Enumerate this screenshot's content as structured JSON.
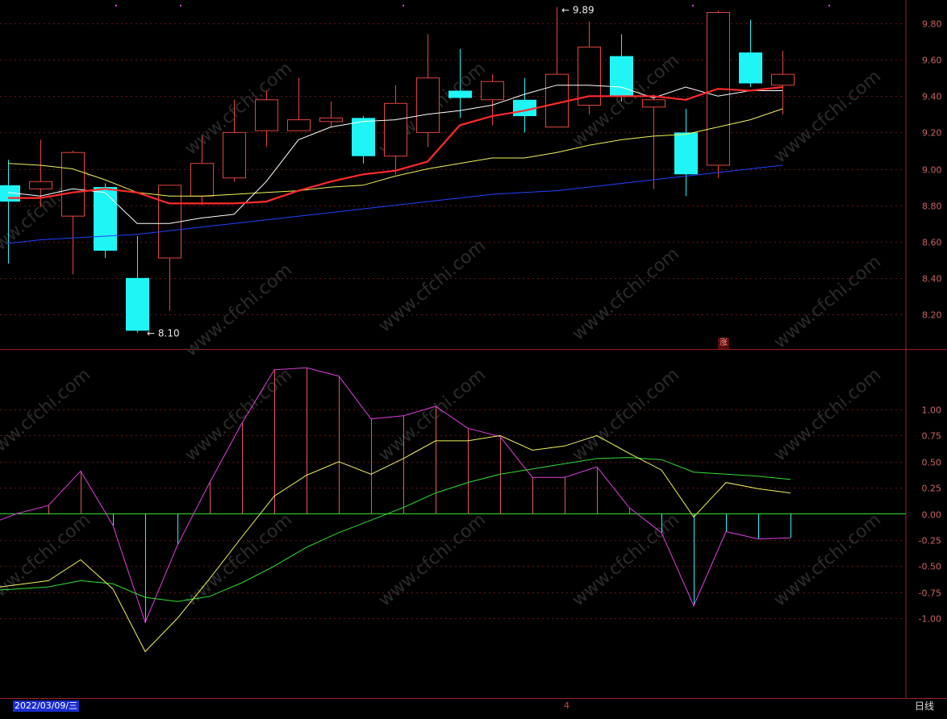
{
  "bottom_bar": {
    "date": "2022/03/09/三",
    "period": "日线",
    "cursor": "4"
  },
  "badge": {
    "rise_char": "涨"
  },
  "watermark": "www.cfchi.com",
  "colors": {
    "up": "#e0463e",
    "down": "#20f5f5",
    "grid": "#6a1414",
    "axis_text": "#c86464",
    "ma5": "#ffffff",
    "ma10": "#ff2a2a",
    "ma20": "#f2f25a",
    "ma60": "#2040ff",
    "dif": "#f2f25a",
    "dea": "#30e030",
    "macd_pos": "#e05a5a",
    "macd_neg": "#20f5f5",
    "macd_line": "#e040e0"
  },
  "chart_data": [
    {
      "type": "candlestick",
      "ylim": [
        8.0,
        9.9
      ],
      "y_ticks": [
        "9.80",
        "9.60",
        "9.40",
        "9.20",
        "9.00",
        "8.80",
        "8.60",
        "8.40",
        "8.20"
      ],
      "annotations": {
        "high": "9.89",
        "low": "8.10"
      },
      "candles": [
        {
          "o": 8.91,
          "h": 9.05,
          "l": 8.48,
          "c": 8.82
        },
        {
          "o": 8.89,
          "h": 9.16,
          "l": 8.79,
          "c": 8.93
        },
        {
          "o": 8.74,
          "h": 9.1,
          "l": 8.42,
          "c": 9.09
        },
        {
          "o": 8.9,
          "h": 8.92,
          "l": 8.51,
          "c": 8.55
        },
        {
          "o": 8.4,
          "h": 8.63,
          "l": 8.1,
          "c": 8.11
        },
        {
          "o": 8.51,
          "h": 8.91,
          "l": 8.22,
          "c": 8.91
        },
        {
          "o": 8.85,
          "h": 9.18,
          "l": 8.8,
          "c": 9.03
        },
        {
          "o": 8.95,
          "h": 9.38,
          "l": 8.93,
          "c": 9.2
        },
        {
          "o": 9.21,
          "h": 9.43,
          "l": 9.12,
          "c": 9.38
        },
        {
          "o": 9.21,
          "h": 9.5,
          "l": 9.21,
          "c": 9.27
        },
        {
          "o": 9.26,
          "h": 9.37,
          "l": 9.23,
          "c": 9.28
        },
        {
          "o": 9.28,
          "h": 9.29,
          "l": 9.03,
          "c": 9.07
        },
        {
          "o": 9.07,
          "h": 9.46,
          "l": 8.97,
          "c": 9.36
        },
        {
          "o": 9.2,
          "h": 9.74,
          "l": 9.12,
          "c": 9.5
        },
        {
          "o": 9.43,
          "h": 9.66,
          "l": 9.28,
          "c": 9.39
        },
        {
          "o": 9.38,
          "h": 9.52,
          "l": 9.24,
          "c": 9.48
        },
        {
          "o": 9.38,
          "h": 9.5,
          "l": 9.2,
          "c": 9.29
        },
        {
          "o": 9.23,
          "h": 9.89,
          "l": 9.23,
          "c": 9.52
        },
        {
          "o": 9.35,
          "h": 9.81,
          "l": 9.3,
          "c": 9.67
        },
        {
          "o": 9.62,
          "h": 9.74,
          "l": 9.37,
          "c": 9.4
        },
        {
          "o": 9.34,
          "h": 9.41,
          "l": 8.89,
          "c": 9.38
        },
        {
          "o": 9.2,
          "h": 9.33,
          "l": 8.85,
          "c": 8.97
        },
        {
          "o": 9.02,
          "h": 9.87,
          "l": 8.95,
          "c": 9.86
        },
        {
          "o": 9.64,
          "h": 9.82,
          "l": 9.45,
          "c": 9.47
        },
        {
          "o": 9.46,
          "h": 9.65,
          "l": 9.3,
          "c": 9.52
        }
      ],
      "ma5": [
        8.87,
        8.85,
        8.89,
        8.87,
        8.7,
        8.7,
        8.73,
        8.75,
        8.93,
        9.16,
        9.23,
        9.26,
        9.27,
        9.3,
        9.32,
        9.35,
        9.41,
        9.46,
        9.46,
        9.45,
        9.39,
        9.45,
        9.4,
        9.43,
        9.43
      ],
      "ma10": [
        8.84,
        8.84,
        8.87,
        8.89,
        8.87,
        8.81,
        8.81,
        8.81,
        8.82,
        8.88,
        8.93,
        8.97,
        8.99,
        9.04,
        9.24,
        9.29,
        9.32,
        9.36,
        9.4,
        9.4,
        9.4,
        9.38,
        9.44,
        9.43,
        9.45
      ],
      "ma20": [
        9.03,
        9.02,
        9.0,
        8.94,
        8.87,
        8.85,
        8.85,
        8.86,
        8.87,
        8.88,
        8.9,
        8.91,
        8.96,
        9.0,
        9.03,
        9.06,
        9.06,
        9.09,
        9.13,
        9.16,
        9.18,
        9.19,
        9.23,
        9.27,
        9.33
      ],
      "ma60": [
        8.59,
        8.61,
        8.62,
        8.63,
        8.64,
        8.66,
        8.68,
        8.7,
        8.72,
        8.74,
        8.76,
        8.78,
        8.8,
        8.82,
        8.84,
        8.86,
        8.87,
        8.88,
        8.9,
        8.92,
        8.94,
        8.96,
        8.98,
        9.0,
        9.02
      ]
    },
    {
      "type": "line",
      "ylim": [
        -1.3,
        1.4
      ],
      "y_ticks": [
        "1.00",
        "0.75",
        "0.50",
        "0.25",
        "0.00",
        "-0.25",
        "-0.50",
        "-0.75",
        "-1.00"
      ],
      "series": [
        {
          "key": "dif",
          "values": [
            -0.72,
            -0.68,
            -0.64,
            -0.44,
            -0.72,
            -1.32,
            -1.0,
            -0.62,
            -0.22,
            0.17,
            0.37,
            0.5,
            0.38,
            0.53,
            0.7,
            0.7,
            0.75,
            0.61,
            0.65,
            0.75,
            0.58,
            0.42,
            -0.03,
            0.3,
            0.24,
            0.2
          ]
        },
        {
          "key": "dea",
          "values": [
            -0.74,
            -0.72,
            -0.7,
            -0.64,
            -0.67,
            -0.8,
            -0.84,
            -0.79,
            -0.66,
            -0.5,
            -0.32,
            -0.18,
            -0.06,
            0.06,
            0.2,
            0.3,
            0.38,
            0.43,
            0.48,
            0.53,
            0.54,
            0.52,
            0.4,
            0.38,
            0.36,
            0.33
          ]
        },
        {
          "key": "macd",
          "values": [
            -0.12,
            0.0,
            0.08,
            0.41,
            -0.11,
            -1.04,
            -0.3,
            0.3,
            0.87,
            1.38,
            1.4,
            1.32,
            0.91,
            0.94,
            1.03,
            0.82,
            0.74,
            0.35,
            0.35,
            0.45,
            0.06,
            -0.18,
            -0.88,
            -0.17,
            -0.24,
            -0.23
          ]
        }
      ]
    }
  ]
}
